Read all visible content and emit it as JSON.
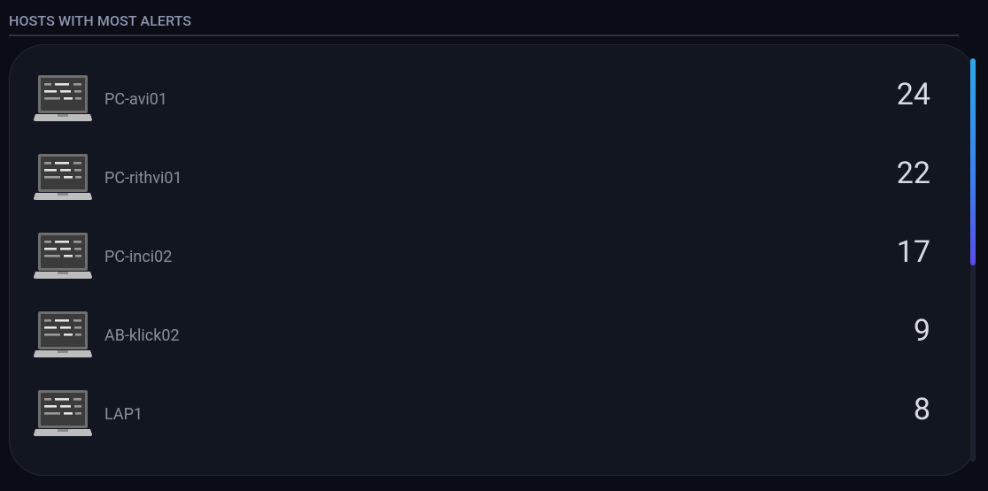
{
  "widget": {
    "title": "HOSTS WITH MOST ALERTS"
  },
  "hosts": [
    {
      "name": "PC-avi01",
      "count": "24",
      "icon": "laptop-icon"
    },
    {
      "name": "PC-rithvi01",
      "count": "22",
      "icon": "laptop-icon"
    },
    {
      "name": "PC-inci02",
      "count": "17",
      "icon": "laptop-icon"
    },
    {
      "name": "AB-klick02",
      "count": "9",
      "icon": "laptop-icon"
    },
    {
      "name": "LAP1",
      "count": "8",
      "icon": "laptop-icon"
    }
  ],
  "colors": {
    "background": "#0b0d16",
    "panel": "#121621",
    "title": "#8f95ad",
    "host_name": "#8d8f99",
    "count": "#d9dbe2",
    "scroll_accent_top": "#2fa7e6",
    "scroll_accent_bottom": "#5a4ee8"
  }
}
